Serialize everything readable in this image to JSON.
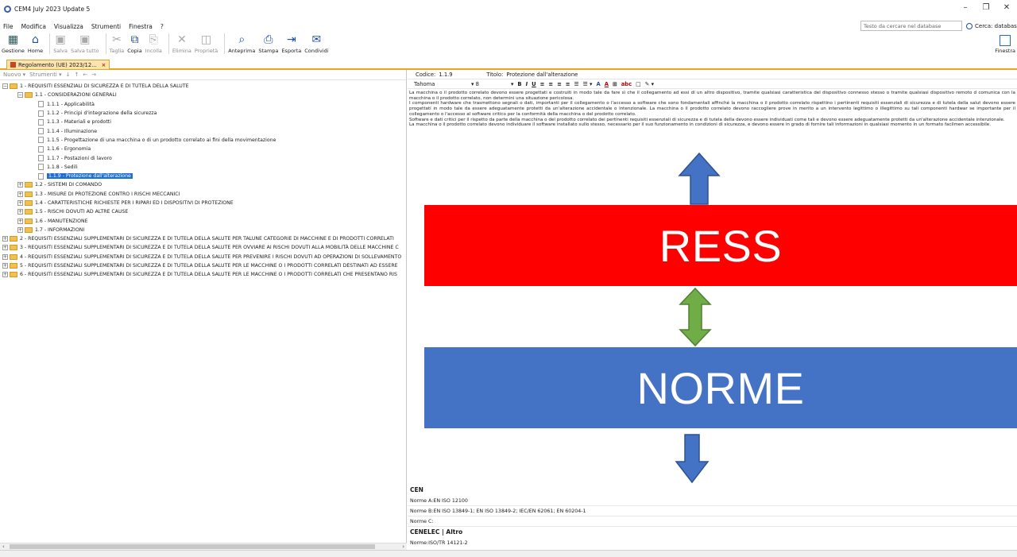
{
  "window": {
    "title": "CEM4 July 2023 Update 5"
  },
  "menu": [
    "File",
    "Modifica",
    "Visualizza",
    "Strumenti",
    "Finestra",
    "?"
  ],
  "search": {
    "placeholder": "Testo da cercare nel database",
    "button": "Cerca: database"
  },
  "toolbar": {
    "buttons": [
      {
        "label": "Gestione",
        "enabled": true
      },
      {
        "label": "Home",
        "enabled": true
      },
      {
        "label": "Salva",
        "enabled": false
      },
      {
        "label": "Salva tutto",
        "enabled": false
      },
      {
        "label": "Taglia",
        "enabled": false
      },
      {
        "label": "Copia",
        "enabled": true
      },
      {
        "label": "Incolla",
        "enabled": false
      },
      {
        "label": "Elimina",
        "enabled": false
      },
      {
        "label": "Proprietà",
        "enabled": false
      },
      {
        "label": "Anteprima",
        "enabled": true
      },
      {
        "label": "Stampa",
        "enabled": true
      },
      {
        "label": "Esporta",
        "enabled": true
      },
      {
        "label": "Condividi",
        "enabled": true
      }
    ],
    "finestra": "Finestra"
  },
  "doc_tab": {
    "label": "Regolamento (UE) 2023/12...",
    "close": "×"
  },
  "left": {
    "subbar": [
      "Nuovo ▾",
      "Strumenti ▾",
      "↓",
      "↑",
      "←",
      "→"
    ],
    "tree": [
      {
        "level": 0,
        "type": "folder",
        "exp": "−",
        "label": "1 - REQUISITI ESSENZIALI DI SICUREZZA E DI TUTELA DELLA SALUTE"
      },
      {
        "level": 1,
        "type": "folder",
        "exp": "−",
        "label": "1.1 - CONSIDERAZIONI GENERALI"
      },
      {
        "level": 2,
        "type": "page",
        "label": "1.1.1 - Applicabilità"
      },
      {
        "level": 2,
        "type": "page",
        "label": "1.1.2 - Principi d'integrazione della sicurezza"
      },
      {
        "level": 2,
        "type": "page",
        "label": "1.1.3 - Materiali e prodotti"
      },
      {
        "level": 2,
        "type": "page",
        "label": "1.1.4 - Illuminazione"
      },
      {
        "level": 2,
        "type": "page",
        "label": "1.1.5 - Progettazione di una macchina o di un prodotto correlato ai fini della movimentazione"
      },
      {
        "level": 2,
        "type": "page",
        "label": "1.1.6 - Ergonomia"
      },
      {
        "level": 2,
        "type": "page",
        "label": "1.1.7 - Postazioni di lavoro"
      },
      {
        "level": 2,
        "type": "page",
        "label": "1.1.8 - Sedili"
      },
      {
        "level": 2,
        "type": "page",
        "label": "1.1.9 - Protezione dall'alterazione",
        "selected": true
      },
      {
        "level": 1,
        "type": "folder",
        "exp": "+",
        "label": "1.2 - SISTEMI DI COMANDO"
      },
      {
        "level": 1,
        "type": "folder",
        "exp": "+",
        "label": "1.3 - MISURE DI PROTEZIONE CONTRO I RISCHI MECCANICI"
      },
      {
        "level": 1,
        "type": "folder",
        "exp": "+",
        "label": "1.4 - CARATTERISTICHE RICHIESTE PER I RIPARI ED I DISPOSITIVI DI PROTEZIONE"
      },
      {
        "level": 1,
        "type": "folder",
        "exp": "+",
        "label": "1.5 - RISCHI DOVUTI AD ALTRE CAUSE"
      },
      {
        "level": 1,
        "type": "folder",
        "exp": "+",
        "label": "1.6 - MANUTENZIONE"
      },
      {
        "level": 1,
        "type": "folder",
        "exp": "+",
        "label": "1.7 - INFORMAZIONI"
      },
      {
        "level": 0,
        "type": "folder",
        "exp": "+",
        "label": "2 - REQUISITI ESSENZIALI SUPPLEMENTARI DI SICUREZZA E DI TUTELA DELLA SALUTE PER TALUNE CATEGORIE DI MACCHINE E DI PRODOTTI CORRELATI"
      },
      {
        "level": 0,
        "type": "folder",
        "exp": "+",
        "label": "3 - REQUISITI ESSENZIALI SUPPLEMENTARI DI SICUREZZA E DI TUTELA DELLA SALUTE PER OVVIARE AI RISCHI DOVUTI ALLA MOBILITÀ DELLE MACCHINE C"
      },
      {
        "level": 0,
        "type": "folder",
        "exp": "+",
        "label": "4 - REQUISITI ESSENZIALI SUPPLEMENTARI DI SICUREZZA E DI TUTELA DELLA SALUTE PER PREVENIRE I RISCHI DOVUTI AD OPERAZIONI DI SOLLEVAMENTO"
      },
      {
        "level": 0,
        "type": "folder",
        "exp": "+",
        "label": "5 - REQUISITI ESSENZIALI SUPPLEMENTARI DI SICUREZZA E DI TUTELA DELLA SALUTE PER LE MACCHINE O I PRODOTTI CORRELATI DESTINATI AD ESSERE"
      },
      {
        "level": 0,
        "type": "folder",
        "exp": "+",
        "label": "6 - REQUISITI ESSENZIALI SUPPLEMENTARI DI SICUREZZA E DI TUTELA DELLA SALUTE PER LE MACCHINE O I PRODOTTI CORRELATI CHE PRESENTANO RIS"
      }
    ]
  },
  "right": {
    "code_label": "Codice:",
    "code_value": "1.1.9",
    "title_label": "Titolo:",
    "title_value": "Protezione dall'alterazione",
    "font": "Tahoma",
    "font_size": "8",
    "format_buttons": [
      "B",
      "I",
      "U",
      "≡",
      "≡",
      "≡",
      "≡",
      "☰",
      "☰ ▾",
      "A",
      "A",
      "⊞",
      "abc",
      "□",
      "✎ ▾"
    ],
    "body": [
      "La macchina o il prodotto correlato devono essere progettati e costruiti in modo tale da fare sì che il collegamento ad essi di un altro dispositivo, tramite qualsiasi caratteristica del dispositivo connesso stesso o tramite qualsiasi dispositivo remoto d comunica con la macchina o il prodotto correlato, non determini una situazione pericolosa.",
      "I componenti hardware che trasmettono segnali o dati, importanti per il collegamento o l'accesso a software che sono fondamentali affinché la macchina o il prodotto correlato rispettino i pertinenti requisiti essenziali di sicurezza e di tutela della salut devono essere progettati in modo tale da essere adeguatamente protetti da un'alterazione accidentale o intenzionale. La macchina o il prodotto correlato devono raccogliere prove in merito a un intervento legittimo o illegittimo su tali componenti hardwar se importante per il collegamento o l'accesso al software critico per la conformità della macchina o del prodotto correlato.",
      "Software e dati critici per il rispetto da parte della macchina o del prodotto correlato dei pertinenti requisiti essenziali di sicurezza e di tutela della devono essere individuati come tali e devono essere adeguatamente protetti da un'alterazione accidentale intenzionale.",
      "La macchina o il prodotto correlato devono individuare il software installato sullo stesso, necessario per il suo funzionamento in condizioni di sicurezza, e devono essere in grado di fornire tali informazioni in qualsiasi momento in un formato facilmen accessibile."
    ]
  },
  "overlay": {
    "ress": "RESS",
    "norme": "NORME",
    "colors": {
      "red": "#ff0000",
      "blue": "#4472c4",
      "arrow_blue": "#4472c4",
      "arrow_green": "#70ad47"
    }
  },
  "norms": {
    "cen_header": "CEN",
    "norme_a": "Norme A:EN ISO 12100",
    "norme_b": "Norme B:EN ISO 13849-1; EN ISO 13849-2; IEC/EN 62061; EN 60204-1",
    "norme_c": "Norme C:",
    "cenelec_header": "CENELEC | Altro",
    "norme_other": "Norme:ISO/TR 14121-2"
  }
}
